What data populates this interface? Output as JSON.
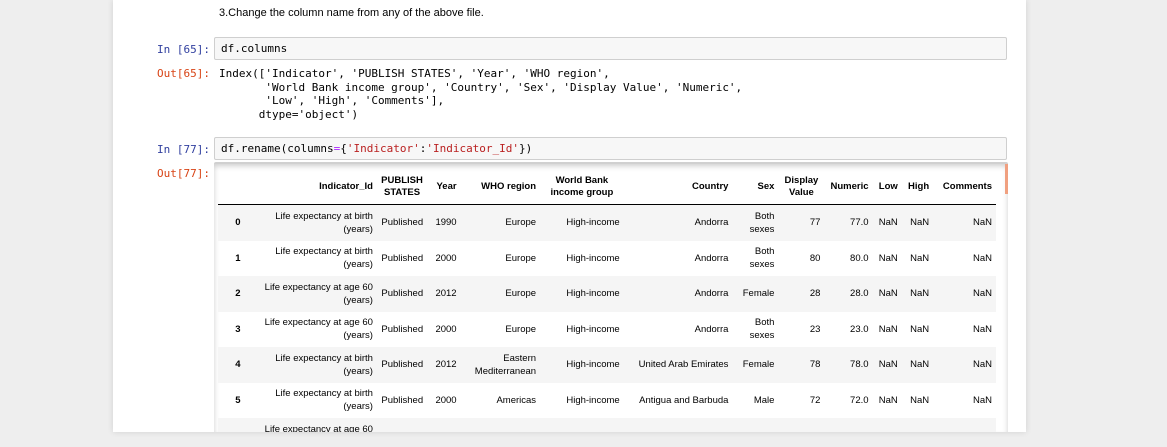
{
  "markdown": {
    "line": "3.Change the column name from any of the above file."
  },
  "cell65": {
    "in_prompt": "In [65]:",
    "code": "df.columns",
    "out_prompt": "Out[65]:",
    "output": "Index(['Indicator', 'PUBLISH STATES', 'Year', 'WHO region',\n       'World Bank income group', 'Country', 'Sex', 'Display Value', 'Numeric',\n       'Low', 'High', 'Comments'],\n      dtype='object')"
  },
  "cell77": {
    "in_prompt": "In [77]:",
    "code_prefix": "df.rename(columns",
    "code_eq": "=",
    "code_brace_open": "{",
    "code_key": "'Indicator'",
    "code_colon": ":",
    "code_val": "'Indicator_Id'",
    "code_suffix": "})",
    "out_prompt": "Out[77]:"
  },
  "table": {
    "headers": [
      "",
      "Indicator_Id",
      "PUBLISH STATES",
      "Year",
      "WHO region",
      "World Bank income group",
      "Country",
      "Sex",
      "Display Value",
      "Numeric",
      "Low",
      "High",
      "Comments"
    ],
    "rows": [
      [
        "0",
        "Life expectancy at birth (years)",
        "Published",
        "1990",
        "Europe",
        "High-income",
        "Andorra",
        "Both sexes",
        "77",
        "77.0",
        "NaN",
        "NaN",
        "NaN"
      ],
      [
        "1",
        "Life expectancy at birth (years)",
        "Published",
        "2000",
        "Europe",
        "High-income",
        "Andorra",
        "Both sexes",
        "80",
        "80.0",
        "NaN",
        "NaN",
        "NaN"
      ],
      [
        "2",
        "Life expectancy at age 60 (years)",
        "Published",
        "2012",
        "Europe",
        "High-income",
        "Andorra",
        "Female",
        "28",
        "28.0",
        "NaN",
        "NaN",
        "NaN"
      ],
      [
        "3",
        "Life expectancy at age 60 (years)",
        "Published",
        "2000",
        "Europe",
        "High-income",
        "Andorra",
        "Both sexes",
        "23",
        "23.0",
        "NaN",
        "NaN",
        "NaN"
      ],
      [
        "4",
        "Life expectancy at birth (years)",
        "Published",
        "2012",
        "Eastern Mediterranean",
        "High-income",
        "United Arab Emirates",
        "Female",
        "78",
        "78.0",
        "NaN",
        "NaN",
        "NaN"
      ],
      [
        "5",
        "Life expectancy at birth (years)",
        "Published",
        "2000",
        "Americas",
        "High-income",
        "Antigua and Barbuda",
        "Male",
        "72",
        "72.0",
        "NaN",
        "NaN",
        "NaN"
      ]
    ],
    "partial_row_text": "Life expectancy at age 60"
  }
}
